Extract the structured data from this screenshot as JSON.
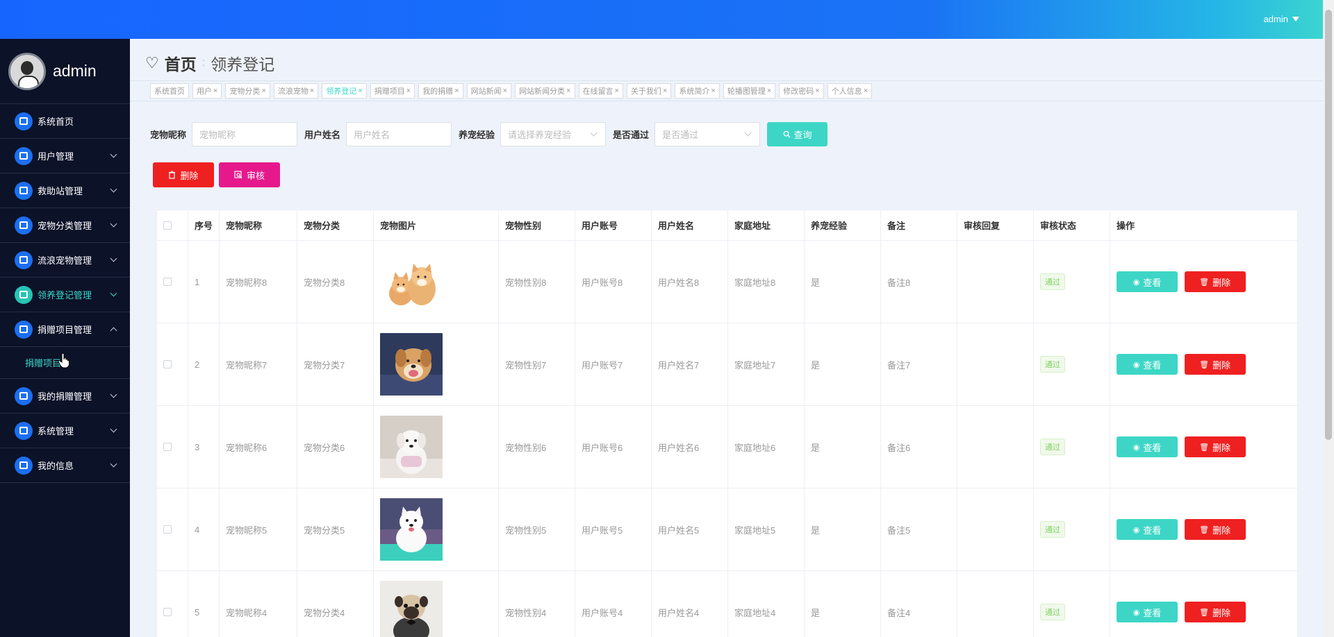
{
  "header": {
    "user": "admin"
  },
  "sidebar": {
    "name": "admin",
    "items": [
      {
        "label": "系统首页",
        "icon": "home-icon"
      },
      {
        "label": "用户管理",
        "icon": "users-icon"
      },
      {
        "label": "救助站管理",
        "icon": "briefcase-icon"
      },
      {
        "label": "宠物分类管理",
        "icon": "person-icon"
      },
      {
        "label": "流浪宠物管理",
        "icon": "clipboard-icon"
      },
      {
        "label": "领养登记管理",
        "icon": "calendar-icon"
      },
      {
        "label": "捐赠项目管理",
        "icon": "clipboard-icon"
      },
      {
        "label": "我的捐赠管理",
        "icon": "grid-icon"
      },
      {
        "label": "系统管理",
        "icon": "grid-icon"
      },
      {
        "label": "我的信息",
        "icon": "card-icon"
      }
    ],
    "sub_item": "捐赠项目"
  },
  "breadcrumb": {
    "home": "首页",
    "current": "领养登记"
  },
  "tags": [
    "系统首页",
    "用户",
    "宠物分类",
    "流浪宠物",
    "领养登记",
    "捐赠项目",
    "我的捐赠",
    "网站新闻",
    "网站新闻分类",
    "在线留言",
    "关于我们",
    "系统简介",
    "轮播图管理",
    "修改密码",
    "个人信息"
  ],
  "filters": {
    "pet_nickname_label": "宠物昵称",
    "pet_nickname_placeholder": "宠物昵称",
    "user_name_label": "用户姓名",
    "user_name_placeholder": "用户姓名",
    "experience_label": "养宠经验",
    "experience_placeholder": "请选择养宠经验",
    "passed_label": "是否通过",
    "passed_placeholder": "是否通过",
    "query_button": "查询"
  },
  "buttons": {
    "delete": "删除",
    "audit": "审核"
  },
  "table": {
    "headers": [
      "序号",
      "宠物昵称",
      "宠物分类",
      "宠物图片",
      "宠物性别",
      "用户账号",
      "用户姓名",
      "家庭地址",
      "养宠经验",
      "备注",
      "审核回复",
      "审核状态",
      "操作"
    ],
    "view_label": "查看",
    "delete_label": "删除",
    "rows": [
      {
        "no": "1",
        "nickname": "宠物昵称8",
        "category": "宠物分类8",
        "gender": "宠物性别8",
        "account": "用户账号8",
        "username": "用户姓名8",
        "address": "家庭地址8",
        "experience": "是",
        "remark": "备注8",
        "reply": "",
        "status": "通过"
      },
      {
        "no": "2",
        "nickname": "宠物昵称7",
        "category": "宠物分类7",
        "gender": "宠物性别7",
        "account": "用户账号7",
        "username": "用户姓名7",
        "address": "家庭地址7",
        "experience": "是",
        "remark": "备注7",
        "reply": "",
        "status": "通过"
      },
      {
        "no": "3",
        "nickname": "宠物昵称6",
        "category": "宠物分类6",
        "gender": "宠物性别6",
        "account": "用户账号6",
        "username": "用户姓名6",
        "address": "家庭地址6",
        "experience": "是",
        "remark": "备注6",
        "reply": "",
        "status": "通过"
      },
      {
        "no": "4",
        "nickname": "宠物昵称5",
        "category": "宠物分类5",
        "gender": "宠物性别5",
        "account": "用户账号5",
        "username": "用户姓名5",
        "address": "家庭地址5",
        "experience": "是",
        "remark": "备注5",
        "reply": "",
        "status": "通过"
      },
      {
        "no": "5",
        "nickname": "宠物昵称4",
        "category": "宠物分类4",
        "gender": "宠物性别4",
        "account": "用户账号4",
        "username": "用户姓名4",
        "address": "家庭地址4",
        "experience": "是",
        "remark": "备注4",
        "reply": "",
        "status": "通过"
      }
    ]
  },
  "colors": {
    "accent": "#3dd6c6",
    "danger": "#ef2020",
    "audit": "#e6198c",
    "sidebar": "#0c1228",
    "primary": "#1765ff"
  }
}
